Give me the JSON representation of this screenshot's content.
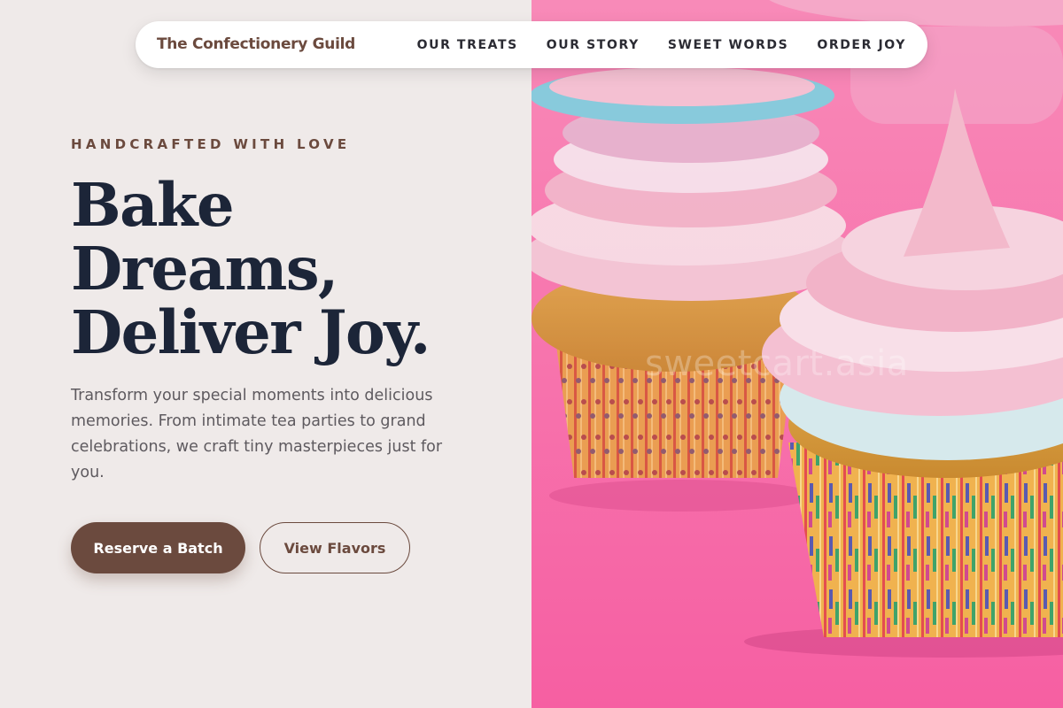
{
  "nav": {
    "brand": "The Confectionery Guild",
    "links": [
      "OUR TREATS",
      "OUR STORY",
      "SWEET WORDS",
      "ORDER JOY"
    ]
  },
  "hero": {
    "eyebrow": "HANDCRAFTED WITH LOVE",
    "headline_lines": [
      "Bake",
      "Dreams,",
      "Deliver Joy."
    ],
    "lede": "Transform your special moments into delicious memories. From intimate tea parties to grand celebrations, we craft tiny masterpieces just for you.",
    "primary_cta": "Reserve a Batch",
    "secondary_cta": "View Flavors"
  },
  "image": {
    "subject": "cupcakes-photo",
    "watermark": "sweetcart.asia"
  },
  "colors": {
    "left_background": "#efeae9",
    "brand_brown": "#6b4a3e",
    "headline_navy": "#1c2538",
    "photo_pink": "#f76aa8"
  }
}
